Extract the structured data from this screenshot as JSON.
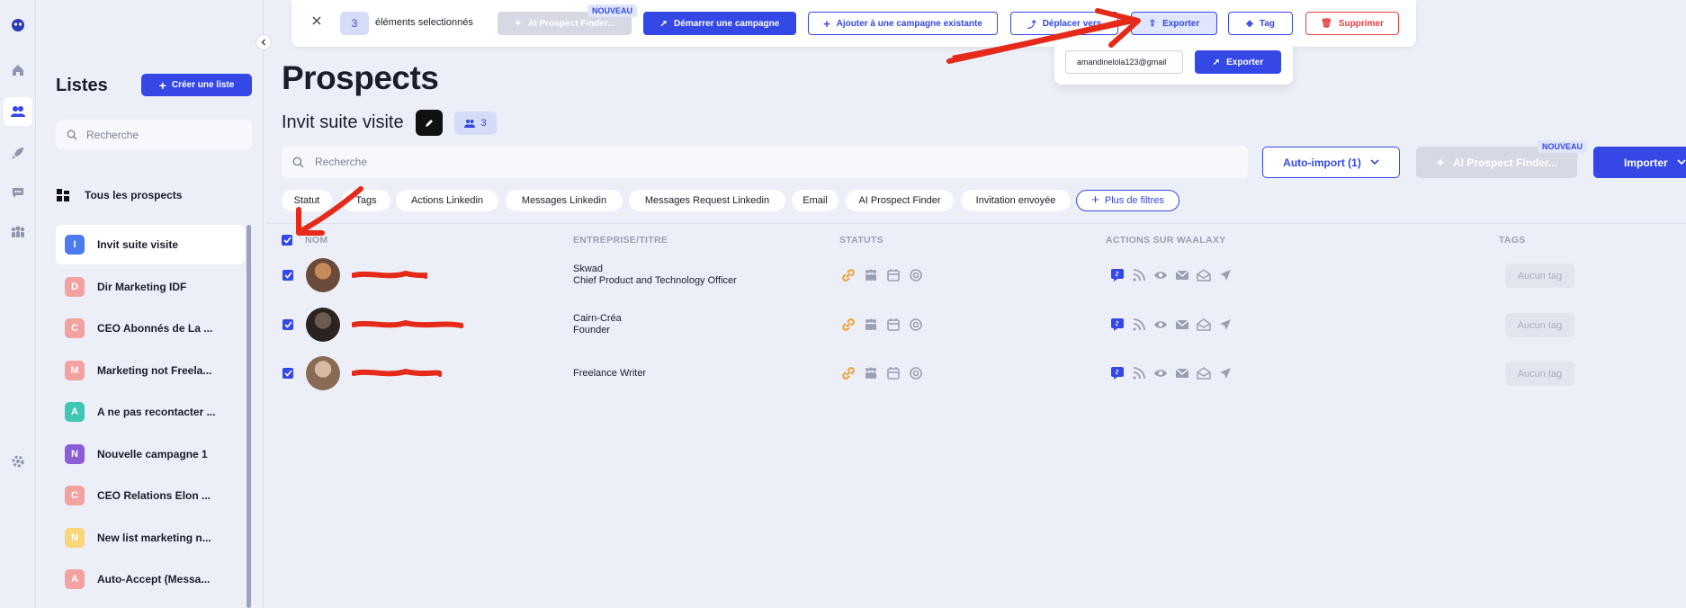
{
  "lists_panel": {
    "title": "Listes",
    "create_button": "Créer une liste",
    "search_placeholder": "Recherche",
    "all_prospects": "Tous les prospects",
    "items": [
      {
        "initial": "I",
        "label": "Invit suite visite",
        "color": "#4a7cf0"
      },
      {
        "initial": "D",
        "label": "Dir Marketing IDF",
        "color": "#f4a1a1"
      },
      {
        "initial": "C",
        "label": "CEO Abonnés de La ...",
        "color": "#f4a1a1"
      },
      {
        "initial": "M",
        "label": "Marketing not Freela...",
        "color": "#f4a1a1"
      },
      {
        "initial": "A",
        "label": "A ne pas recontacter ...",
        "color": "#3fc7b6"
      },
      {
        "initial": "N",
        "label": "Nouvelle campagne 1",
        "color": "#8a5cd6"
      },
      {
        "initial": "C",
        "label": "CEO Relations Elon ...",
        "color": "#f4a1a1"
      },
      {
        "initial": "N",
        "label": "New list marketing n...",
        "color": "#f8d778"
      },
      {
        "initial": "A",
        "label": "Auto-Accept (Messa...",
        "color": "#f4a1a1"
      }
    ]
  },
  "selection_toolbar": {
    "count": "3",
    "selected_label": "éléments selectionnés",
    "ai_finder": "AI Prospect Finder...",
    "nouveau": "NOUVEAU",
    "start_campaign": "Démarrer une campagne",
    "add_existing": "Ajouter à une campagne existante",
    "move_to": "Déplacer vers",
    "export": "Exporter",
    "tag": "Tag",
    "delete": "Supprimer"
  },
  "export_popover": {
    "email": "amandinelola123@gmail",
    "button": "Exporter"
  },
  "header": {
    "title": "Prospects",
    "list_name": "Invit suite visite",
    "list_count": "3"
  },
  "search_placeholder": "Recherche",
  "actions": {
    "auto_import": "Auto-import (1)",
    "ai_finder": "AI Prospect Finder...",
    "nouveau": "NOUVEAU",
    "import": "Importer"
  },
  "filters": [
    "Statut",
    "Tags",
    "Actions Linkedin",
    "Messages Linkedin",
    "Messages Request Linkedin",
    "Email",
    "AI Prospect Finder",
    "Invitation envoyée"
  ],
  "more_filters": "Plus de filtres",
  "table": {
    "columns": [
      "NOM",
      "ENTREPRISE/TITRE",
      "STATUTS",
      "ACTIONS SUR WAALAXY",
      "TAGS"
    ],
    "rows": [
      {
        "company": "Skwad",
        "title": "Chief Product and Technology Officer",
        "tag": "Aucun tag"
      },
      {
        "company": "Cairn-Créa",
        "title": "Founder",
        "tag": "Aucun tag"
      },
      {
        "company": "",
        "title": "Freelance Writer",
        "tag": "Aucun tag"
      }
    ]
  },
  "colors": {
    "primary": "#3448e6",
    "danger": "#e44040",
    "status_orange": "#f0a030",
    "annotation_red": "#e52a1a"
  }
}
